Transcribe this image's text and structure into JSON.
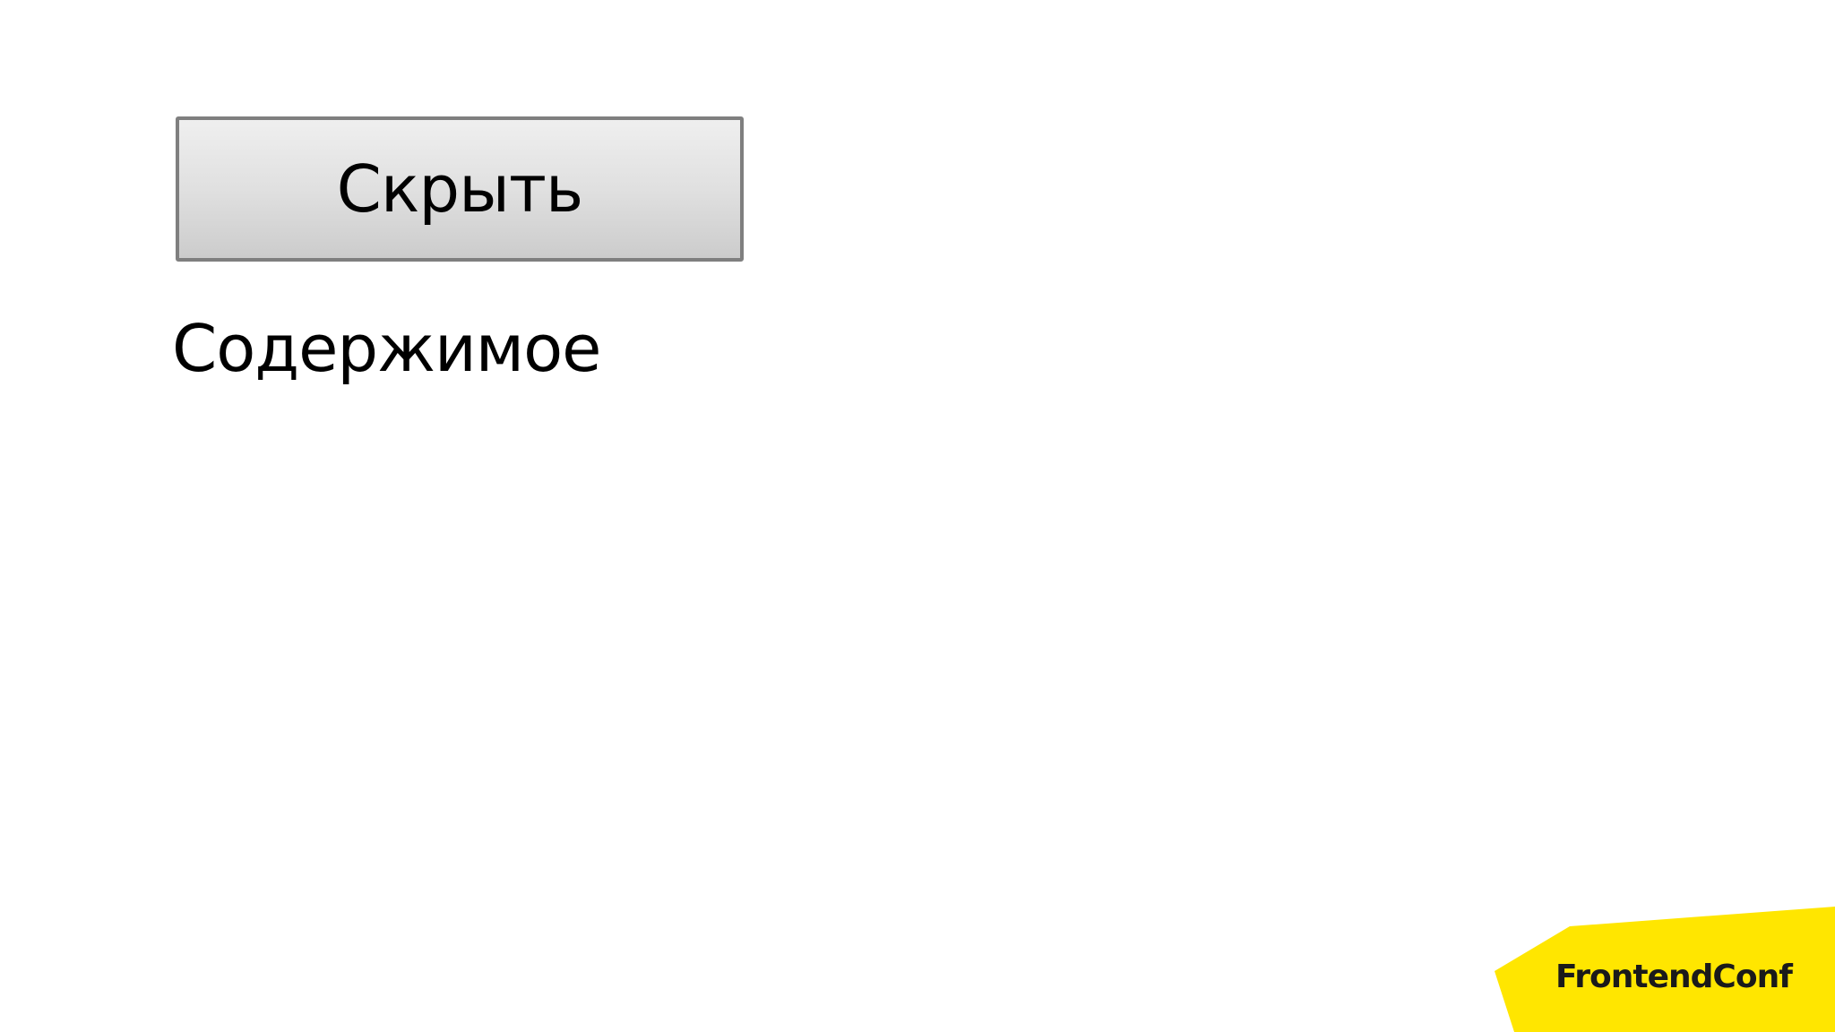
{
  "slide": {
    "toggle_button_label": "Скрыть",
    "content_text": "Содержимое"
  },
  "brand": {
    "name": "FrontendConf",
    "accent_color": "#ffe600"
  }
}
